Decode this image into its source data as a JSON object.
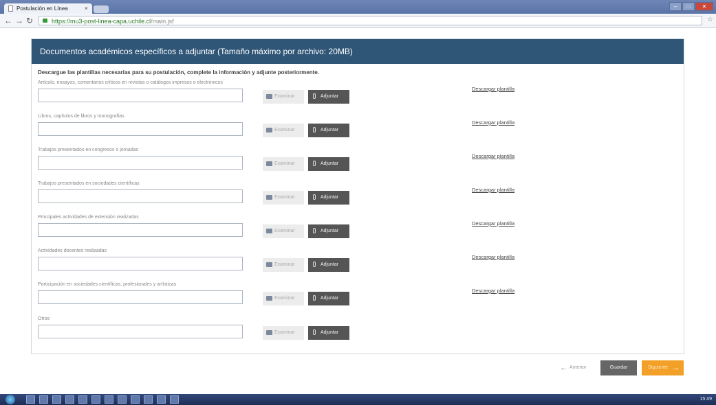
{
  "browser": {
    "tab_title": "Postulación en Línea",
    "tab_close": "×",
    "url_scheme": "https://",
    "url_host": "mu3-post-linea-capa.uchile.cl",
    "url_path": "/main.jsf"
  },
  "panel": {
    "title": "Documentos académicos específicos a adjuntar (Tamaño máximo por archivo: 20MB)",
    "instructions": "Descargue las plantillas necesarias para su postulación, complete la información y adjunte posteriormente."
  },
  "rows": [
    {
      "label": "Artículo, ensayos, comentarios críticos en revistas o catálogos impresos o electrónicos",
      "download": "Descargar plantilla"
    },
    {
      "label": "Libros, capítulos de libros y monografías",
      "download": "Descargar plantilla"
    },
    {
      "label": "Trabajos presentados en congresos o jornadas",
      "download": "Descargar plantilla"
    },
    {
      "label": "Trabajos presentados en sociedades científicas",
      "download": "Descargar plantilla"
    },
    {
      "label": "Principales actividades de extensión realizadas",
      "download": "Descargar plantilla"
    },
    {
      "label": "Actividades docentes realizadas",
      "download": "Descargar plantilla"
    },
    {
      "label": "Participación en sociedades científicas, profesionales y artísticas",
      "download": "Descargar plantilla"
    },
    {
      "label": "Otros",
      "download": ""
    }
  ],
  "buttons": {
    "examinar": "Examinar",
    "adjuntar": "Adjuntar",
    "anterior": "Anterior",
    "guardar": "Guardar",
    "siguiente": "Siguiente"
  },
  "taskbar": {
    "clock": "15:49"
  },
  "colors": {
    "header": "#2f5577",
    "siguiente": "#f3a028",
    "adjuntar": "#555555"
  }
}
